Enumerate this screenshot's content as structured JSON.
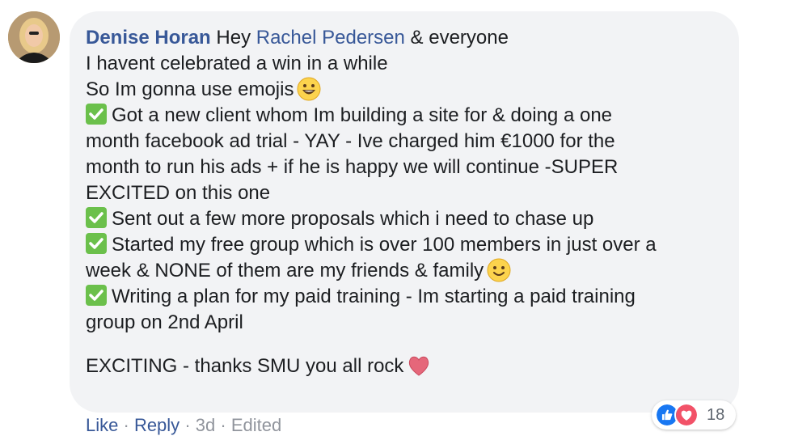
{
  "comment": {
    "author": "Denise Horan",
    "greeting_prefix": "Hey",
    "mention": "Rachel Pedersen",
    "greeting_suffix": "& everyone",
    "lines": [
      "I havent celebrated a win in a while",
      "So Im gonna use emojis",
      "Got a new client whom Im building a site for & doing a one",
      "month facebook ad trial - YAY - Ive charged him €1000 for the",
      "month to run his ads + if he is happy we will continue -SUPER",
      "EXCITED on this one",
      "Sent out a few more proposals which i need to chase up",
      "Started my free group which is over 100 members in just over a",
      "week & NONE of them are my friends & family",
      "Writing a plan for my paid training - Im starting a paid training",
      "group on 2nd April",
      "EXCITING - thanks SMU you all rock"
    ]
  },
  "reactions": {
    "icons": [
      "like-reaction-icon",
      "love-reaction-icon"
    ],
    "count": "18"
  },
  "actions": {
    "like": "Like",
    "reply": "Reply",
    "time": "3d",
    "edited": "Edited",
    "separator": "·"
  },
  "colors": {
    "author": "#385898",
    "bubble": "#f2f3f5",
    "check": "#6bc04b",
    "like": "#1877f2",
    "love": "#f25268"
  }
}
